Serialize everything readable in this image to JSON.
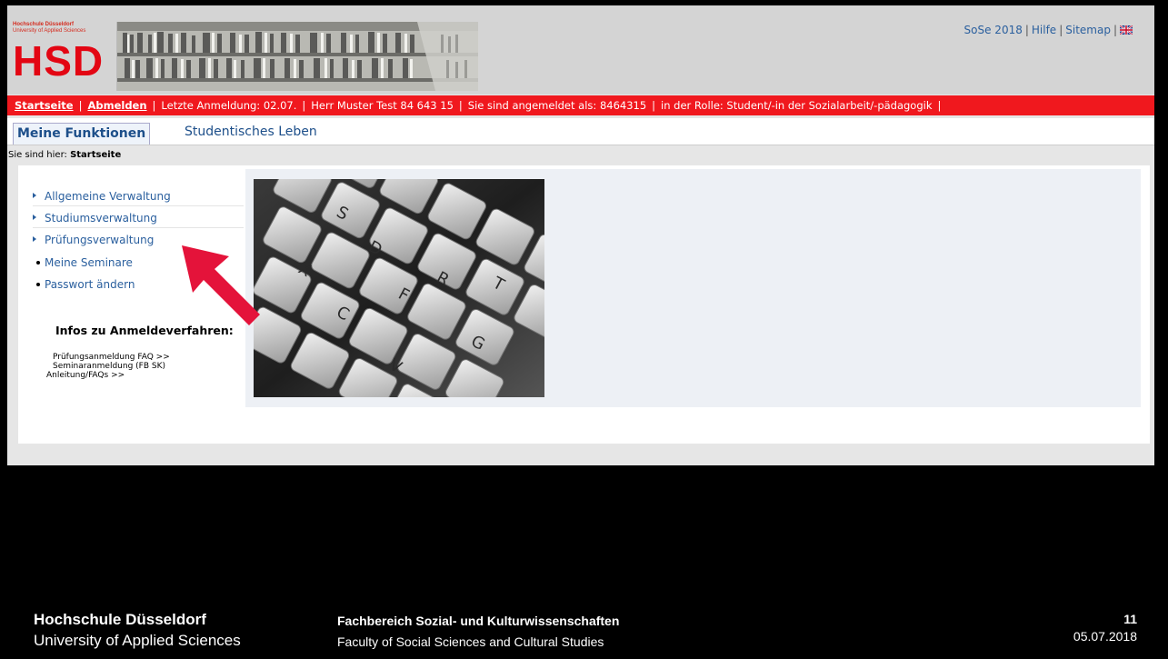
{
  "banner": {
    "logo_line1": "Hochschule Düsseldorf",
    "logo_line2": "University of Applied Sciences",
    "logo_mark": "HSD",
    "photo_icon": "library-bookshelf-photo"
  },
  "toplinks": {
    "semester": "SoSe 2018",
    "help": "Hilfe",
    "sitemap": "Sitemap",
    "language_icon": "uk-flag-icon"
  },
  "statusbar": {
    "home": "Startseite",
    "logout": "Abmelden",
    "last_login": "Letzte Anmeldung:  02.07.",
    "user": "Herr Muster Test 84 643 15",
    "logged_in_as": "Sie sind angemeldet als: 8464315",
    "role": "in der Rolle: Student/-in der Sozialarbeit/-pädagogik",
    "color": "#f0181e"
  },
  "tabs": {
    "active": "Meine Funktionen",
    "other": "Studentisches Leben"
  },
  "breadcrumb": {
    "prefix": "Sie sind hier:",
    "current": "Startseite"
  },
  "leftnav": {
    "items": [
      {
        "label": "Allgemeine Verwaltung"
      },
      {
        "label": "Studiumsverwaltung"
      },
      {
        "label": "Prüfungsverwaltung"
      },
      {
        "label": "Meine Seminare"
      },
      {
        "label": "Passwort ändern"
      }
    ],
    "infos_title": "Infos zu Anmeldeverfahren:",
    "infos_link1": "Prüfungsanmeldung FAQ >>",
    "infos_link2a": "Seminaranmeldung (FB SK)",
    "infos_link2b": "Anleitung/FAQs >>"
  },
  "main": {
    "photo_icon": "keyboard-photo"
  },
  "annotation": {
    "arrow_icon": "red-arrow-icon",
    "arrow_color": "#e4133a"
  },
  "footer": {
    "org_name": "Hochschule Düsseldorf",
    "org_sub": "University of Applied Sciences",
    "department": "Fachbereich Sozial- und Kulturwissenschaften",
    "department_en": "Faculty of Social Sciences and Cultural Studies",
    "page_number": "11",
    "date": "05.07.2018"
  }
}
